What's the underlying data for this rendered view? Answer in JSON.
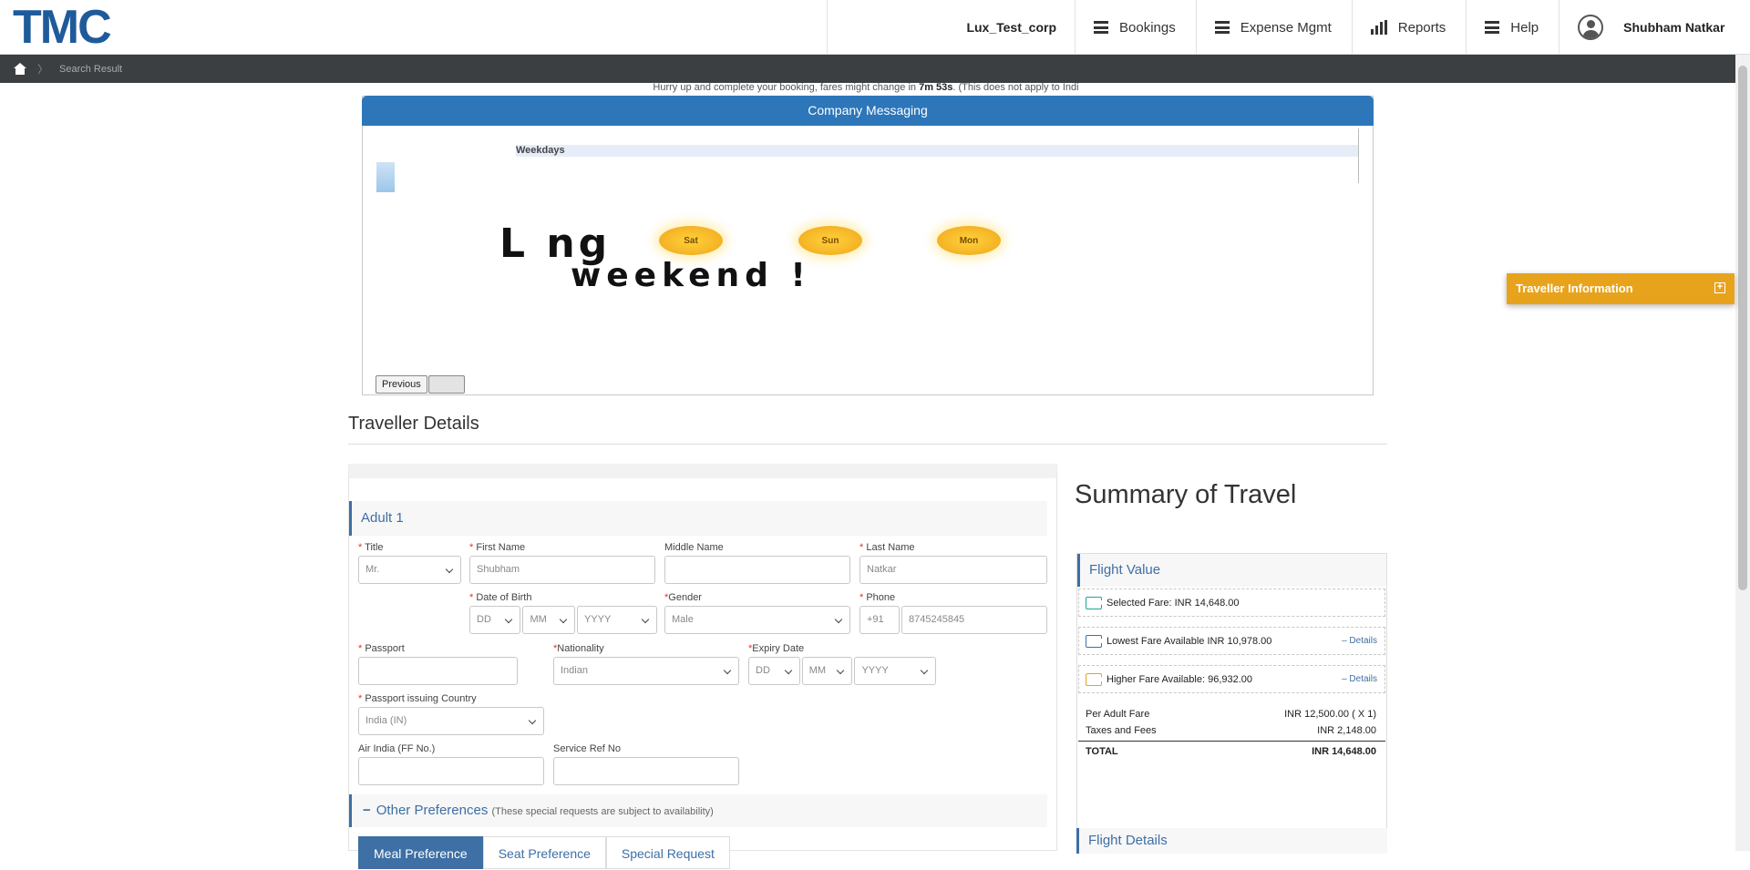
{
  "header": {
    "logo": "TMC",
    "corp": "Lux_Test_corp",
    "nav": [
      {
        "label": "Bookings",
        "icon": "menu-icon"
      },
      {
        "label": "Expense Mgmt",
        "icon": "menu-icon"
      },
      {
        "label": "Reports",
        "icon": "bar-chart-icon"
      },
      {
        "label": "Help",
        "icon": "menu-icon"
      }
    ],
    "user": "Shubham Natkar"
  },
  "breadcrumb": {
    "items": [
      "Search Result"
    ]
  },
  "timer": {
    "prefix": "Hurry up and complete your booking, fares might change in ",
    "time": "7m 53s",
    "suffix": ". (This does not apply to Indi"
  },
  "messaging": {
    "title": "Company Messaging",
    "weekdays": "Weekdays",
    "banner_line1": "L          ng",
    "banner_line2": "weekend !",
    "suns": [
      "Sat",
      "Sun",
      "Mon"
    ],
    "prev_label": "Previous"
  },
  "traveller_tab": {
    "label": "Traveller Information",
    "icon": "plus-icon"
  },
  "traveller": {
    "title": "Traveller Details",
    "adult_label": "Adult 1",
    "fields": {
      "title": {
        "label": "Title",
        "value": "Mr."
      },
      "first_name": {
        "label": "First Name",
        "value": "Shubham"
      },
      "middle_name": {
        "label": "Middle Name",
        "value": ""
      },
      "last_name": {
        "label": "Last Name",
        "value": "Natkar"
      },
      "dob": {
        "label": "Date of Birth",
        "dd": "DD",
        "mm": "MM",
        "yyyy": "YYYY"
      },
      "gender": {
        "label": "Gender",
        "value": "Male"
      },
      "phone": {
        "label": "Phone",
        "code": "+91",
        "value": "8745245845"
      },
      "passport": {
        "label": "Passport",
        "value": ""
      },
      "nationality": {
        "label": "Nationality",
        "value": "Indian"
      },
      "expiry": {
        "label": "Expiry Date",
        "dd": "DD",
        "mm": "MM",
        "yyyy": "YYYY"
      },
      "passport_country": {
        "label": "Passport issuing Country",
        "value": "India (IN)"
      },
      "ff_no": {
        "label": "Air India (FF No.)",
        "value": ""
      },
      "service_ref": {
        "label": "Service Ref No",
        "value": ""
      }
    },
    "other_prefs": {
      "label": "Other Preferences",
      "note": "(These special requests are subject to availability)"
    },
    "pref_tabs": [
      "Meal Preference",
      "Seat Preference",
      "Special Request"
    ]
  },
  "summary": {
    "title": "Summary of Travel",
    "flight_value": "Flight Value",
    "selected_fare": "Selected Fare: INR 14,648.00",
    "lowest_fare": "Lowest Fare Available INR 10,978.00",
    "higher_fare": "Higher Fare Available: 96,932.00",
    "details_label": "Details",
    "per_adult_label": "Per Adult Fare",
    "per_adult_value": "INR 12,500.00 ( X 1)",
    "taxes_label": "Taxes and Fees",
    "taxes_value": "INR 2,148.00",
    "total_label": "TOTAL",
    "total_value": "INR 14,648.00",
    "flight_details": "Flight Details"
  }
}
